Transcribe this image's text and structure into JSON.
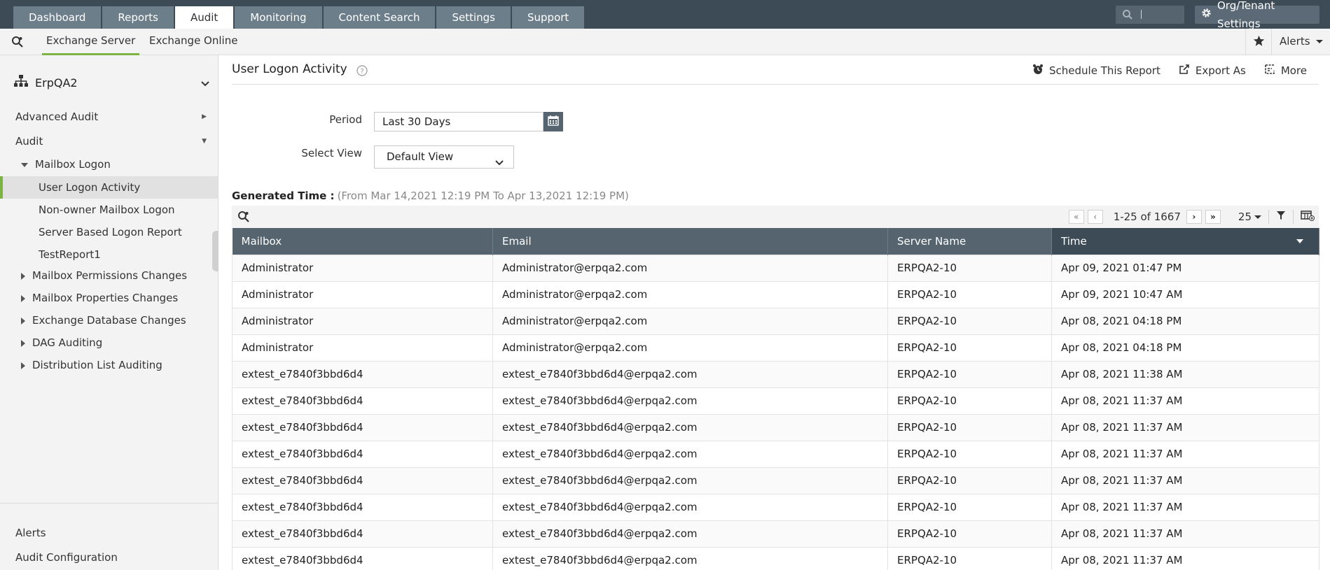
{
  "top_nav": {
    "tabs": [
      "Dashboard",
      "Reports",
      "Audit",
      "Monitoring",
      "Content Search",
      "Settings",
      "Support"
    ],
    "active_tab": "Audit",
    "org_button": "Org/Tenant Settings"
  },
  "sub_nav": {
    "tabs": [
      "Exchange Server",
      "Exchange Online"
    ],
    "alerts": "Alerts"
  },
  "sidebar": {
    "tenant": "ErpQA2",
    "advanced_audit": "Advanced Audit",
    "audit": "Audit",
    "mailbox_logon": "Mailbox Logon",
    "children": [
      "User Logon Activity",
      "Non-owner Mailbox Logon",
      "Server Based Logon Report",
      "TestReport1"
    ],
    "groups": [
      "Mailbox Permissions Changes",
      "Mailbox Properties Changes",
      "Exchange Database Changes",
      "DAG Auditing",
      "Distribution List Auditing"
    ],
    "bottom": [
      "Alerts",
      "Audit Configuration"
    ]
  },
  "report": {
    "title": "User Logon Activity",
    "actions": {
      "schedule": "Schedule This Report",
      "export": "Export As",
      "more": "More"
    },
    "period_label": "Period",
    "period_value": "Last 30 Days",
    "view_label": "Select View",
    "view_value": "Default View",
    "generated_label": "Generated Time :",
    "generated_range": "(From Mar 14,2021 12:19 PM To Apr 13,2021 12:19 PM)",
    "pager_info": "1-25 of 1667",
    "page_size": "25"
  },
  "table": {
    "columns": [
      "Mailbox",
      "Email",
      "Server Name",
      "Time"
    ],
    "rows": [
      [
        "Administrator",
        "Administrator@erpqa2.com",
        "ERPQA2-10",
        "Apr 09, 2021 01:47 PM"
      ],
      [
        "Administrator",
        "Administrator@erpqa2.com",
        "ERPQA2-10",
        "Apr 09, 2021 10:47 AM"
      ],
      [
        "Administrator",
        "Administrator@erpqa2.com",
        "ERPQA2-10",
        "Apr 08, 2021 04:18 PM"
      ],
      [
        "Administrator",
        "Administrator@erpqa2.com",
        "ERPQA2-10",
        "Apr 08, 2021 04:18 PM"
      ],
      [
        "extest_e7840f3bbd6d4",
        "extest_e7840f3bbd6d4@erpqa2.com",
        "ERPQA2-10",
        "Apr 08, 2021 11:38 AM"
      ],
      [
        "extest_e7840f3bbd6d4",
        "extest_e7840f3bbd6d4@erpqa2.com",
        "ERPQA2-10",
        "Apr 08, 2021 11:37 AM"
      ],
      [
        "extest_e7840f3bbd6d4",
        "extest_e7840f3bbd6d4@erpqa2.com",
        "ERPQA2-10",
        "Apr 08, 2021 11:37 AM"
      ],
      [
        "extest_e7840f3bbd6d4",
        "extest_e7840f3bbd6d4@erpqa2.com",
        "ERPQA2-10",
        "Apr 08, 2021 11:37 AM"
      ],
      [
        "extest_e7840f3bbd6d4",
        "extest_e7840f3bbd6d4@erpqa2.com",
        "ERPQA2-10",
        "Apr 08, 2021 11:37 AM"
      ],
      [
        "extest_e7840f3bbd6d4",
        "extest_e7840f3bbd6d4@erpqa2.com",
        "ERPQA2-10",
        "Apr 08, 2021 11:37 AM"
      ],
      [
        "extest_e7840f3bbd6d4",
        "extest_e7840f3bbd6d4@erpqa2.com",
        "ERPQA2-10",
        "Apr 08, 2021 11:37 AM"
      ],
      [
        "extest_e7840f3bbd6d4",
        "extest_e7840f3bbd6d4@erpqa2.com",
        "ERPQA2-10",
        "Apr 08, 2021 11:37 AM"
      ]
    ]
  },
  "colors": {
    "topbar": "#3d4b56",
    "tab": "#6d7e8b",
    "accent": "#7cb342",
    "header": "#55646f"
  }
}
